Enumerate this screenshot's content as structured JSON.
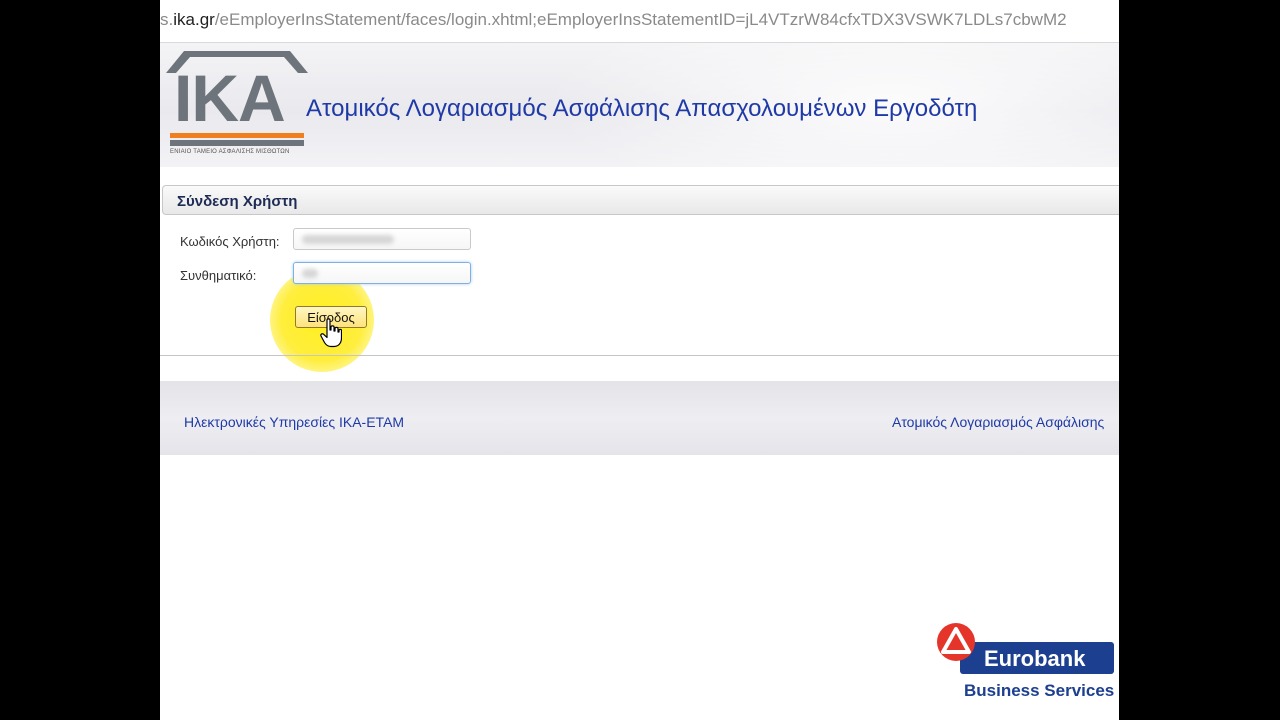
{
  "browser": {
    "url_prefix": "s.",
    "url_host": "ika.gr",
    "url_path": "/eEmployerInsStatement/faces/login.xhtml;eEmployerInsStatementID=jL4VTzrW84cfxTDX3VSWK7LDLs7cbwM2"
  },
  "header": {
    "logo_text": "IKA",
    "logo_tagline": "ΕΝΙΑΙΟ ΤΑΜΕΙΟ ΑΣΦΑΛΙΣΗΣ ΜΙΣΘΩΤΩΝ",
    "title": "Ατομικός Λογαριασμός Ασφάλισης Απασχολουμένων Εργοδότη"
  },
  "login": {
    "panel_title": "Σύνδεση Χρήστη",
    "username_label": "Κωδικός Χρήστη:",
    "password_label": "Συνθηματικό:",
    "submit_label": "Είσοδος"
  },
  "footer": {
    "left_link": "Ηλεκτρονικές Υπηρεσίες ΙΚΑ-ΕΤΑΜ",
    "right_link": "Ατομικός Λογαριασμός Ασφάλισης"
  },
  "watermark": {
    "brand": "Eurobank",
    "subtitle": "Business Services"
  },
  "colors": {
    "title_blue": "#1f3aa6",
    "ika_orange": "#f07f1f",
    "ika_grey": "#6e747b",
    "highlight_yellow": "#ffef14",
    "eurobank_blue": "#1d3f8f",
    "eurobank_red": "#e5352b"
  }
}
